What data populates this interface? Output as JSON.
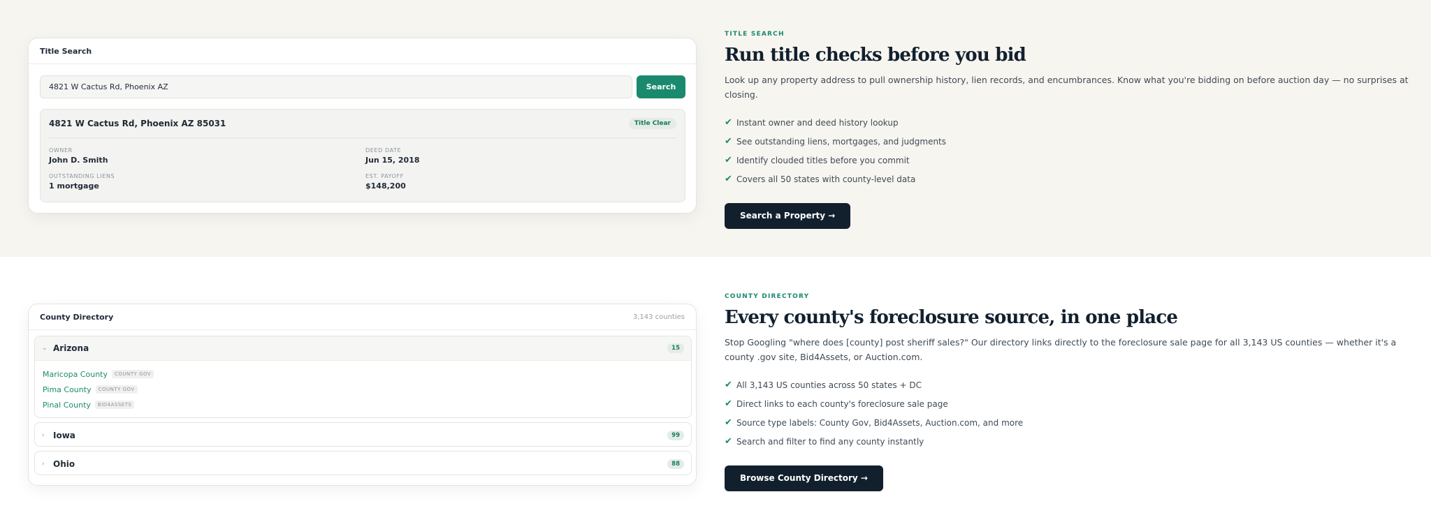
{
  "title_search": {
    "card_title": "Title Search",
    "search_value": "4821 W Cactus Rd, Phoenix AZ",
    "search_button": "Search",
    "result": {
      "address": "4821 W Cactus Rd, Phoenix AZ 85031",
      "status": "Title Clear",
      "owner_label": "OWNER",
      "owner_value": "John D. Smith",
      "deed_label": "DEED DATE",
      "deed_value": "Jun 15, 2018",
      "liens_label": "OUTSTANDING LIENS",
      "liens_value": "1 mortgage",
      "payoff_label": "EST. PAYOFF",
      "payoff_value": "$148,200"
    },
    "eyebrow": "TITLE SEARCH",
    "headline": "Run title checks before you bid",
    "description": "Look up any property address to pull ownership history, lien records, and encumbrances. Know what you're bidding on before auction day — no surprises at closing.",
    "features": [
      "Instant owner and deed history lookup",
      "See outstanding liens, mortgages, and judgments",
      "Identify clouded titles before you commit",
      "Covers all 50 states with county-level data"
    ],
    "cta": "Search a Property →"
  },
  "county_directory": {
    "card_title": "County Directory",
    "count": "3,143 counties",
    "groups": [
      {
        "name": "Arizona",
        "count": "15",
        "expanded": true,
        "counties": [
          {
            "name": "Maricopa County",
            "tag": "COUNTY GOV"
          },
          {
            "name": "Pima County",
            "tag": "COUNTY GOV"
          },
          {
            "name": "Pinal County",
            "tag": "BID4ASSETS"
          }
        ]
      },
      {
        "name": "Iowa",
        "count": "99",
        "expanded": false
      },
      {
        "name": "Ohio",
        "count": "88",
        "expanded": false
      }
    ],
    "eyebrow": "COUNTY DIRECTORY",
    "headline": "Every county's foreclosure source, in one place",
    "description": "Stop Googling \"where does [county] post sheriff sales?\" Our directory links directly to the foreclosure sale page for all 3,143 US counties — whether it's a county .gov site, Bid4Assets, or Auction.com.",
    "features": [
      "All 3,143 US counties across 50 states + DC",
      "Direct links to each county's foreclosure sale page",
      "Source type labels: County Gov, Bid4Assets, Auction.com, and more",
      "Search and filter to find any county instantly"
    ],
    "cta": "Browse County Directory →"
  },
  "icons": {
    "check": "✔",
    "chevron_down": "⌄",
    "chevron_right": "›"
  },
  "colors": {
    "accent": "#1a8a6e",
    "navy": "#12202e",
    "section_bg": "#f7f5f0"
  }
}
